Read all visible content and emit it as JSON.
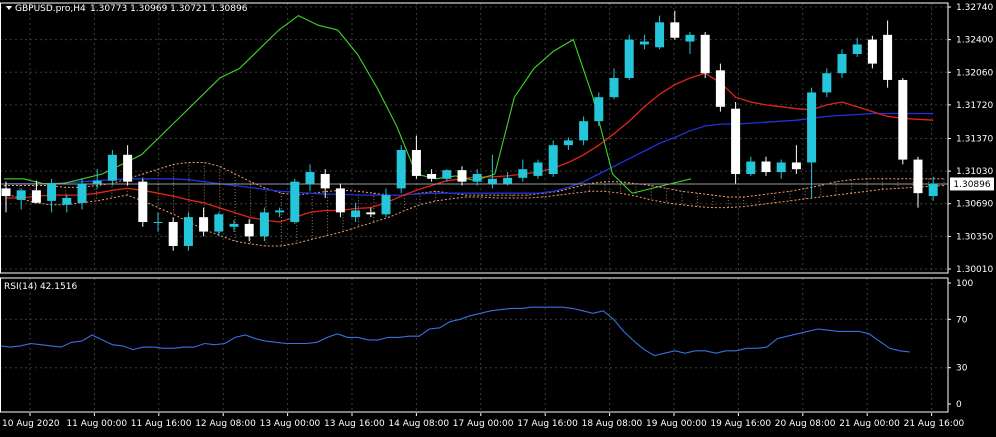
{
  "colors": {
    "background": "#000000",
    "grid": "#3c3c3c",
    "axis": "#ffffff",
    "bull": "#26c6da",
    "bear": "#ffffff",
    "ma_red": "#e0241b",
    "ma_blue": "#1f33d8",
    "ichimoku_green": "#3fd42a",
    "cloud_dots": "#f0a070",
    "rsi_line": "#3a6fe0",
    "price_tag_bg": "#ffffff",
    "price_tag_text": "#000000"
  },
  "header": {
    "symbol_label": "GBPUSD.pro,H4",
    "ohlc_text": "1.30773 1.30969 1.30721 1.30896"
  },
  "rsi_label": "RSI(14) 42.1516",
  "chart_data": {
    "type": "candlestick",
    "symbol": "GBPUSD.pro",
    "timeframe": "H4",
    "price_axis": {
      "ticks": [
        "1.32740",
        "1.32400",
        "1.32060",
        "1.31720",
        "1.31370",
        "1.31030",
        "1.30690",
        "1.30350",
        "1.30010"
      ],
      "ylim": [
        1.3001,
        1.3274
      ]
    },
    "current_price": "1.30896",
    "time_axis": {
      "labels": [
        "10 Aug 2020",
        "11 Aug 00:00",
        "11 Aug 16:00",
        "12 Aug 08:00",
        "13 Aug 00:00",
        "13 Aug 16:00",
        "14 Aug 08:00",
        "17 Aug 00:00",
        "17 Aug 16:00",
        "18 Aug 08:00",
        "19 Aug 00:00",
        "19 Aug 16:00",
        "20 Aug 08:00",
        "21 Aug 00:00",
        "21 Aug 16:00"
      ]
    },
    "candles": [
      {
        "o": 1.3085,
        "h": 1.3092,
        "l": 1.306,
        "c": 1.3077
      },
      {
        "o": 1.3073,
        "h": 1.3085,
        "l": 1.3063,
        "c": 1.3083
      },
      {
        "o": 1.3083,
        "h": 1.3093,
        "l": 1.307,
        "c": 1.307
      },
      {
        "o": 1.3072,
        "h": 1.3095,
        "l": 1.306,
        "c": 1.309
      },
      {
        "o": 1.3068,
        "h": 1.3078,
        "l": 1.306,
        "c": 1.3075
      },
      {
        "o": 1.307,
        "h": 1.3095,
        "l": 1.3063,
        "c": 1.309
      },
      {
        "o": 1.309,
        "h": 1.3105,
        "l": 1.3085,
        "c": 1.3093
      },
      {
        "o": 1.3093,
        "h": 1.3125,
        "l": 1.3088,
        "c": 1.312
      },
      {
        "o": 1.312,
        "h": 1.313,
        "l": 1.3088,
        "c": 1.3092
      },
      {
        "o": 1.3092,
        "h": 1.3095,
        "l": 1.3045,
        "c": 1.305
      },
      {
        "o": 1.305,
        "h": 1.306,
        "l": 1.304,
        "c": 1.305
      },
      {
        "o": 1.305,
        "h": 1.3055,
        "l": 1.302,
        "c": 1.3025
      },
      {
        "o": 1.3025,
        "h": 1.306,
        "l": 1.302,
        "c": 1.3055
      },
      {
        "o": 1.3055,
        "h": 1.3065,
        "l": 1.3035,
        "c": 1.304
      },
      {
        "o": 1.304,
        "h": 1.306,
        "l": 1.3035,
        "c": 1.3058
      },
      {
        "o": 1.3045,
        "h": 1.3052,
        "l": 1.304,
        "c": 1.3048
      },
      {
        "o": 1.3048,
        "h": 1.3053,
        "l": 1.303,
        "c": 1.3035
      },
      {
        "o": 1.3035,
        "h": 1.3065,
        "l": 1.303,
        "c": 1.306
      },
      {
        "o": 1.306,
        "h": 1.3065,
        "l": 1.3055,
        "c": 1.3062
      },
      {
        "o": 1.305,
        "h": 1.3095,
        "l": 1.3048,
        "c": 1.3092
      },
      {
        "o": 1.309,
        "h": 1.311,
        "l": 1.3082,
        "c": 1.3102
      },
      {
        "o": 1.31,
        "h": 1.3105,
        "l": 1.3075,
        "c": 1.3085
      },
      {
        "o": 1.3085,
        "h": 1.309,
        "l": 1.3055,
        "c": 1.306
      },
      {
        "o": 1.3055,
        "h": 1.307,
        "l": 1.305,
        "c": 1.3062
      },
      {
        "o": 1.306,
        "h": 1.3065,
        "l": 1.3055,
        "c": 1.3058
      },
      {
        "o": 1.3058,
        "h": 1.3085,
        "l": 1.3055,
        "c": 1.3078
      },
      {
        "o": 1.3085,
        "h": 1.313,
        "l": 1.308,
        "c": 1.3125
      },
      {
        "o": 1.3125,
        "h": 1.314,
        "l": 1.3095,
        "c": 1.3098
      },
      {
        "o": 1.31,
        "h": 1.3105,
        "l": 1.3092,
        "c": 1.3095
      },
      {
        "o": 1.3095,
        "h": 1.3105,
        "l": 1.3092,
        "c": 1.3104
      },
      {
        "o": 1.3104,
        "h": 1.3108,
        "l": 1.3088,
        "c": 1.3092
      },
      {
        "o": 1.3092,
        "h": 1.3105,
        "l": 1.3088,
        "c": 1.31
      },
      {
        "o": 1.309,
        "h": 1.312,
        "l": 1.3085,
        "c": 1.3095
      },
      {
        "o": 1.309,
        "h": 1.3102,
        "l": 1.3088,
        "c": 1.3096
      },
      {
        "o": 1.3096,
        "h": 1.3115,
        "l": 1.3092,
        "c": 1.3105
      },
      {
        "o": 1.3098,
        "h": 1.3115,
        "l": 1.3095,
        "c": 1.3112
      },
      {
        "o": 1.31,
        "h": 1.3135,
        "l": 1.3097,
        "c": 1.313
      },
      {
        "o": 1.313,
        "h": 1.3138,
        "l": 1.3125,
        "c": 1.3135
      },
      {
        "o": 1.3135,
        "h": 1.316,
        "l": 1.313,
        "c": 1.3155
      },
      {
        "o": 1.3155,
        "h": 1.3185,
        "l": 1.315,
        "c": 1.318
      },
      {
        "o": 1.318,
        "h": 1.321,
        "l": 1.3178,
        "c": 1.32
      },
      {
        "o": 1.32,
        "h": 1.3245,
        "l": 1.3198,
        "c": 1.324
      },
      {
        "o": 1.3235,
        "h": 1.3245,
        "l": 1.323,
        "c": 1.3238
      },
      {
        "o": 1.3232,
        "h": 1.3265,
        "l": 1.323,
        "c": 1.3258
      },
      {
        "o": 1.3258,
        "h": 1.327,
        "l": 1.324,
        "c": 1.3242
      },
      {
        "o": 1.3238,
        "h": 1.3248,
        "l": 1.3225,
        "c": 1.3245
      },
      {
        "o": 1.3245,
        "h": 1.3248,
        "l": 1.32,
        "c": 1.3205
      },
      {
        "o": 1.3208,
        "h": 1.3215,
        "l": 1.3165,
        "c": 1.317
      },
      {
        "o": 1.3168,
        "h": 1.3175,
        "l": 1.309,
        "c": 1.31
      },
      {
        "o": 1.31,
        "h": 1.3118,
        "l": 1.3098,
        "c": 1.3113
      },
      {
        "o": 1.3113,
        "h": 1.3118,
        "l": 1.3098,
        "c": 1.3102
      },
      {
        "o": 1.3102,
        "h": 1.3115,
        "l": 1.3095,
        "c": 1.3112
      },
      {
        "o": 1.3112,
        "h": 1.313,
        "l": 1.31,
        "c": 1.3105
      },
      {
        "o": 1.3112,
        "h": 1.319,
        "l": 1.3075,
        "c": 1.3185
      },
      {
        "o": 1.3185,
        "h": 1.321,
        "l": 1.318,
        "c": 1.3205
      },
      {
        "o": 1.3205,
        "h": 1.323,
        "l": 1.32,
        "c": 1.3225
      },
      {
        "o": 1.3225,
        "h": 1.3242,
        "l": 1.3222,
        "c": 1.3235
      },
      {
        "o": 1.324,
        "h": 1.3244,
        "l": 1.321,
        "c": 1.3215
      },
      {
        "o": 1.3245,
        "h": 1.326,
        "l": 1.319,
        "c": 1.3198
      },
      {
        "o": 1.3198,
        "h": 1.32,
        "l": 1.311,
        "c": 1.3115
      },
      {
        "o": 1.3115,
        "h": 1.3118,
        "l": 1.3065,
        "c": 1.308
      },
      {
        "o": 1.3077,
        "h": 1.3097,
        "l": 1.3072,
        "c": 1.309
      }
    ],
    "ma_red": [
      1.3075,
      1.3075,
      1.3077,
      1.3078,
      1.3078,
      1.3078,
      1.308,
      1.3083,
      1.3085,
      1.3083,
      1.308,
      1.3077,
      1.3073,
      1.307,
      1.3065,
      1.306,
      1.3055,
      1.3052,
      1.305,
      1.3055,
      1.306,
      1.3062,
      1.3062,
      1.3064,
      1.3065,
      1.307,
      1.3077,
      1.3083,
      1.3088,
      1.3093,
      1.3095,
      1.3097,
      1.3097,
      1.3098,
      1.31,
      1.3102,
      1.3106,
      1.3112,
      1.312,
      1.313,
      1.3142,
      1.3155,
      1.317,
      1.3183,
      1.3193,
      1.32,
      1.3205,
      1.3195,
      1.318,
      1.3175,
      1.3172,
      1.317,
      1.3168,
      1.3167,
      1.3172,
      1.3175,
      1.317,
      1.3165,
      1.316,
      1.3158,
      1.3157,
      1.3156
    ],
    "ma_blue": [
      1.309,
      1.309,
      1.309,
      1.309,
      1.3091,
      1.3092,
      1.3093,
      1.3094,
      1.3095,
      1.3095,
      1.3095,
      1.3095,
      1.3094,
      1.3092,
      1.309,
      1.3088,
      1.3086,
      1.3084,
      1.3082,
      1.3081,
      1.308,
      1.3079,
      1.3079,
      1.3078,
      1.3078,
      1.3078,
      1.3078,
      1.3079,
      1.308,
      1.308,
      1.308,
      1.308,
      1.308,
      1.308,
      1.308,
      1.308,
      1.3082,
      1.3086,
      1.3092,
      1.31,
      1.3108,
      1.3116,
      1.3124,
      1.3132,
      1.3138,
      1.3145,
      1.315,
      1.3152,
      1.3152,
      1.3153,
      1.3154,
      1.3155,
      1.3156,
      1.3158,
      1.316,
      1.3161,
      1.3162,
      1.3163,
      1.3163,
      1.3163,
      1.3163,
      1.3163
    ],
    "ichimoku_green": [
      1.3095,
      1.3095,
      1.309,
      1.309,
      1.3095,
      1.31,
      1.311,
      1.312,
      1.314,
      1.316,
      1.318,
      1.32,
      1.321,
      1.323,
      1.325,
      1.3265,
      1.3255,
      1.325,
      1.3225,
      1.319,
      1.315,
      1.31,
      1.3095,
      1.3098,
      1.3093,
      1.31,
      1.318,
      1.321,
      1.3228,
      1.324,
      1.318,
      1.31,
      1.308,
      1.3085,
      1.309,
      1.3095
    ],
    "cloud_upper": [
      1.3088,
      1.3088,
      1.3088,
      1.3088,
      1.3086,
      1.3086,
      1.3088,
      1.309,
      1.3095,
      1.31,
      1.3105,
      1.311,
      1.3112,
      1.3112,
      1.3108,
      1.31,
      1.3092,
      1.3085,
      1.308,
      1.3078,
      1.308,
      1.3082,
      1.3083,
      1.3082,
      1.308,
      1.3078,
      1.3078,
      1.308,
      1.3082,
      1.308,
      1.3078,
      1.3078,
      1.3078,
      1.3078,
      1.3078,
      1.308,
      1.3082,
      1.3086,
      1.309,
      1.3092,
      1.3092,
      1.309,
      1.3088,
      1.3085,
      1.3082,
      1.308,
      1.3078,
      1.3076,
      1.3076,
      1.3078,
      1.308,
      1.3082,
      1.3085,
      1.3088,
      1.3092,
      1.3094,
      1.3095,
      1.3095,
      1.3095,
      1.3095,
      1.3095,
      1.3095
    ],
    "cloud_lower": [
      1.308,
      1.3075,
      1.307,
      1.3068,
      1.3068,
      1.307,
      1.3072,
      1.3075,
      1.3078,
      1.3072,
      1.3065,
      1.3058,
      1.305,
      1.3042,
      1.3036,
      1.303,
      1.3027,
      1.3025,
      1.3025,
      1.3028,
      1.3032,
      1.3036,
      1.304,
      1.3045,
      1.305,
      1.3055,
      1.3062,
      1.3068,
      1.3072,
      1.3074,
      1.3076,
      1.3076,
      1.3075,
      1.3075,
      1.3075,
      1.3076,
      1.3078,
      1.308,
      1.3082,
      1.3082,
      1.308,
      1.3077,
      1.3073,
      1.307,
      1.3068,
      1.3066,
      1.3065,
      1.3065,
      1.3066,
      1.3068,
      1.307,
      1.3072,
      1.3074,
      1.3076,
      1.3078,
      1.308,
      1.3082,
      1.3084,
      1.3085,
      1.3086,
      1.3087,
      1.3088
    ],
    "rsi": {
      "axis_ticks": [
        "100",
        "70",
        "30",
        "0"
      ],
      "ylim": [
        0,
        100
      ],
      "values": [
        48,
        47,
        48,
        50,
        49,
        48,
        47,
        51,
        52,
        57,
        53,
        49,
        48,
        45,
        47,
        47,
        46,
        46,
        47,
        47,
        50,
        49,
        50,
        55,
        57,
        54,
        52,
        51,
        50,
        50,
        50,
        51,
        55,
        58,
        55,
        55,
        53,
        53,
        55,
        55,
        56,
        56,
        62,
        63,
        68,
        70,
        73,
        75,
        77,
        78,
        79,
        79,
        80,
        80,
        80,
        80,
        79,
        77,
        75,
        77,
        70,
        60,
        52,
        45,
        40,
        42,
        44,
        42,
        44,
        44,
        42,
        44,
        44,
        46,
        46,
        47,
        54,
        56,
        58,
        60,
        62,
        61,
        60,
        60,
        60,
        58,
        52,
        46,
        44,
        43
      ]
    }
  }
}
